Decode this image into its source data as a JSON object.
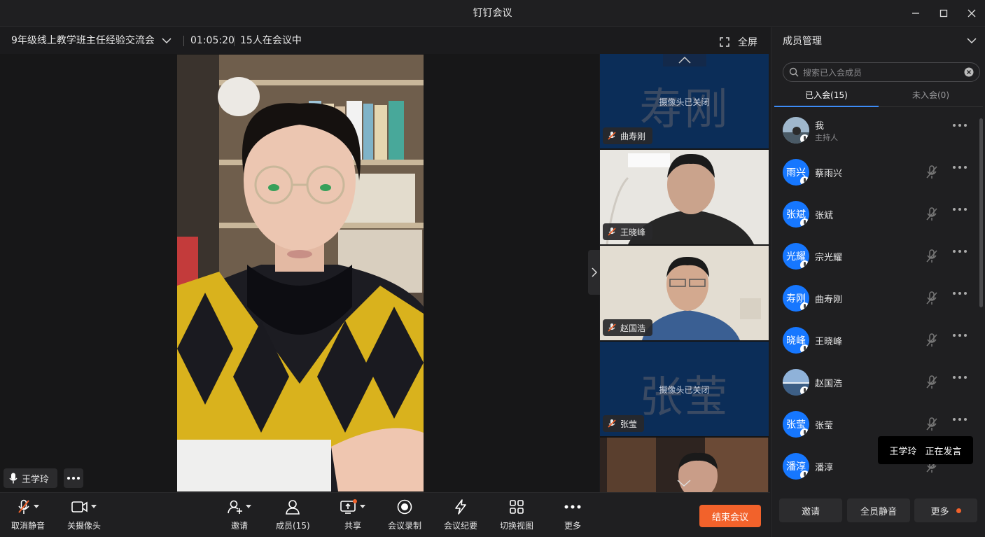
{
  "window": {
    "title": "钉钉会议"
  },
  "meeting": {
    "name": "9年级线上教学班主任经验交流会",
    "elapsed": "01:05:20",
    "participants_text": "15人在会议中",
    "fullscreen_label": "全屏"
  },
  "main_video": {
    "speaker": "王学玲"
  },
  "thumbnails": [
    {
      "name": "曲寿刚",
      "big_name": "寿刚",
      "camera_off": true,
      "status": "摄像头已关闭"
    },
    {
      "name": "王晓峰",
      "camera_off": false
    },
    {
      "name": "赵国浩",
      "camera_off": false
    },
    {
      "name": "张莹",
      "big_name": "张莹",
      "camera_off": true,
      "status": "摄像头已关闭"
    },
    {
      "name": "",
      "camera_off": false
    }
  ],
  "toolbar": {
    "unmute": "取消静音",
    "camera_off": "关摄像头",
    "invite": "邀请",
    "members": "成员(15)",
    "share": "共享",
    "record": "会议录制",
    "minutes": "会议纪要",
    "switch_view": "切换视图",
    "more": "更多",
    "end": "结束会议"
  },
  "panel": {
    "title": "成员管理",
    "search_placeholder": "搜索已入会成员",
    "tab_joined": "已入会(15)",
    "tab_not_joined": "未入会(0)",
    "members": [
      {
        "name": "我",
        "role": "主持人",
        "avatar_text": "",
        "photo": true
      },
      {
        "name": "蔡雨兴",
        "avatar_text": "雨兴"
      },
      {
        "name": "张斌",
        "avatar_text": "张斌"
      },
      {
        "name": "宗光耀",
        "avatar_text": "光耀"
      },
      {
        "name": "曲寿刚",
        "avatar_text": "寿刚"
      },
      {
        "name": "王晓峰",
        "avatar_text": "晓峰"
      },
      {
        "name": "赵国浩",
        "avatar_text": "",
        "photo": true
      },
      {
        "name": "张莹",
        "avatar_text": "张莹"
      },
      {
        "name": "潘淳",
        "avatar_text": "潘淳"
      }
    ],
    "tooltip": {
      "name": "王学玲",
      "status": "正在发言"
    },
    "buttons": {
      "invite": "邀请",
      "mute_all": "全员静音",
      "more": "更多"
    }
  },
  "colors": {
    "accent": "#1677ff",
    "end_button": "#f2622b",
    "camera_off_bg": "#0b2d58"
  }
}
